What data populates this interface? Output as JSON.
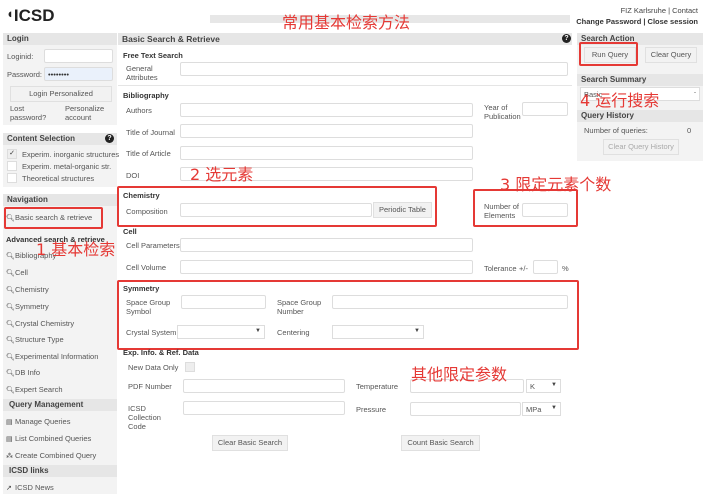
{
  "header": {
    "logo": "ICSD",
    "title_annotation": "常用基本检索方法",
    "top_links": "FIZ Karlsruhe | Contact",
    "account_links": "Change Password | Close session"
  },
  "login": {
    "title": "Login",
    "loginid_label": "Loginid:",
    "password_label": "Password:",
    "password_value": "••••••••",
    "login_button": "Login Personalized",
    "lost_password": "Lost password?",
    "personalize": "Personalize account"
  },
  "content_selection": {
    "title": "Content Selection",
    "items": [
      {
        "label": "Experim. inorganic structures",
        "checked": true
      },
      {
        "label": "Experim. metal-organic str.",
        "checked": false
      },
      {
        "label": "Theoretical structures",
        "checked": false
      }
    ]
  },
  "navigation": {
    "title": "Navigation",
    "basic": "Basic search & retrieve",
    "advanced_title": "Advanced search & retrieve",
    "advanced": [
      "Bibliography",
      "Cell",
      "Chemistry",
      "Symmetry",
      "Crystal Chemistry",
      "Structure Type",
      "Experimental Information",
      "DB Info",
      "Expert Search"
    ],
    "query_mgmt_title": "Query Management",
    "query_mgmt": [
      "Manage Queries",
      "List Combined Queries",
      "Create Combined Query"
    ],
    "links_title": "ICSD links",
    "links": [
      "ICSD News"
    ]
  },
  "main": {
    "title": "Basic Search & Retrieve",
    "free_text": "Free Text Search",
    "general_attributes": "General Attributes",
    "bibliography": "Bibliography",
    "authors": "Authors",
    "year": "Year of Publication",
    "journal": "Title of Journal",
    "article": "Title of Article",
    "doi": "DOI",
    "chemistry": "Chemistry",
    "composition": "Composition",
    "periodic_table": "Periodic Table",
    "num_elements": "Number of Elements",
    "cell": "Cell",
    "cell_params": "Cell Parameters",
    "cell_volume": "Cell Volume",
    "tolerance": "Tolerance",
    "plusminus": "+/-",
    "percent": "%",
    "symmetry": "Symmetry",
    "sg_symbol": "Space Group Symbol",
    "sg_number": "Space Group Number",
    "crystal_system": "Crystal System",
    "centering": "Centering",
    "exp": "Exp. Info. & Ref. Data",
    "new_data": "New Data Only",
    "pdf": "PDF Number",
    "temperature": "Temperature",
    "temp_unit": "K",
    "collection_code": "ICSD Collection Code",
    "pressure": "Pressure",
    "pressure_unit": "MPa",
    "clear_basic": "Clear Basic Search",
    "count_basic": "Count Basic Search"
  },
  "right": {
    "search_action": "Search Action",
    "run_query": "Run Query",
    "clear_query": "Clear Query",
    "search_summary": "Search Summary",
    "summary_value": "Basic",
    "query_history": "Query History",
    "num_queries_label": "Number of queries:",
    "num_queries": "0",
    "clear_history": "Clear Query History"
  },
  "annotations": {
    "a1": "1 基本检索",
    "a2": "2 选元素",
    "a3": "3 限定元素个数",
    "a4": "4 运行搜索",
    "a5": "其他限定参数"
  }
}
